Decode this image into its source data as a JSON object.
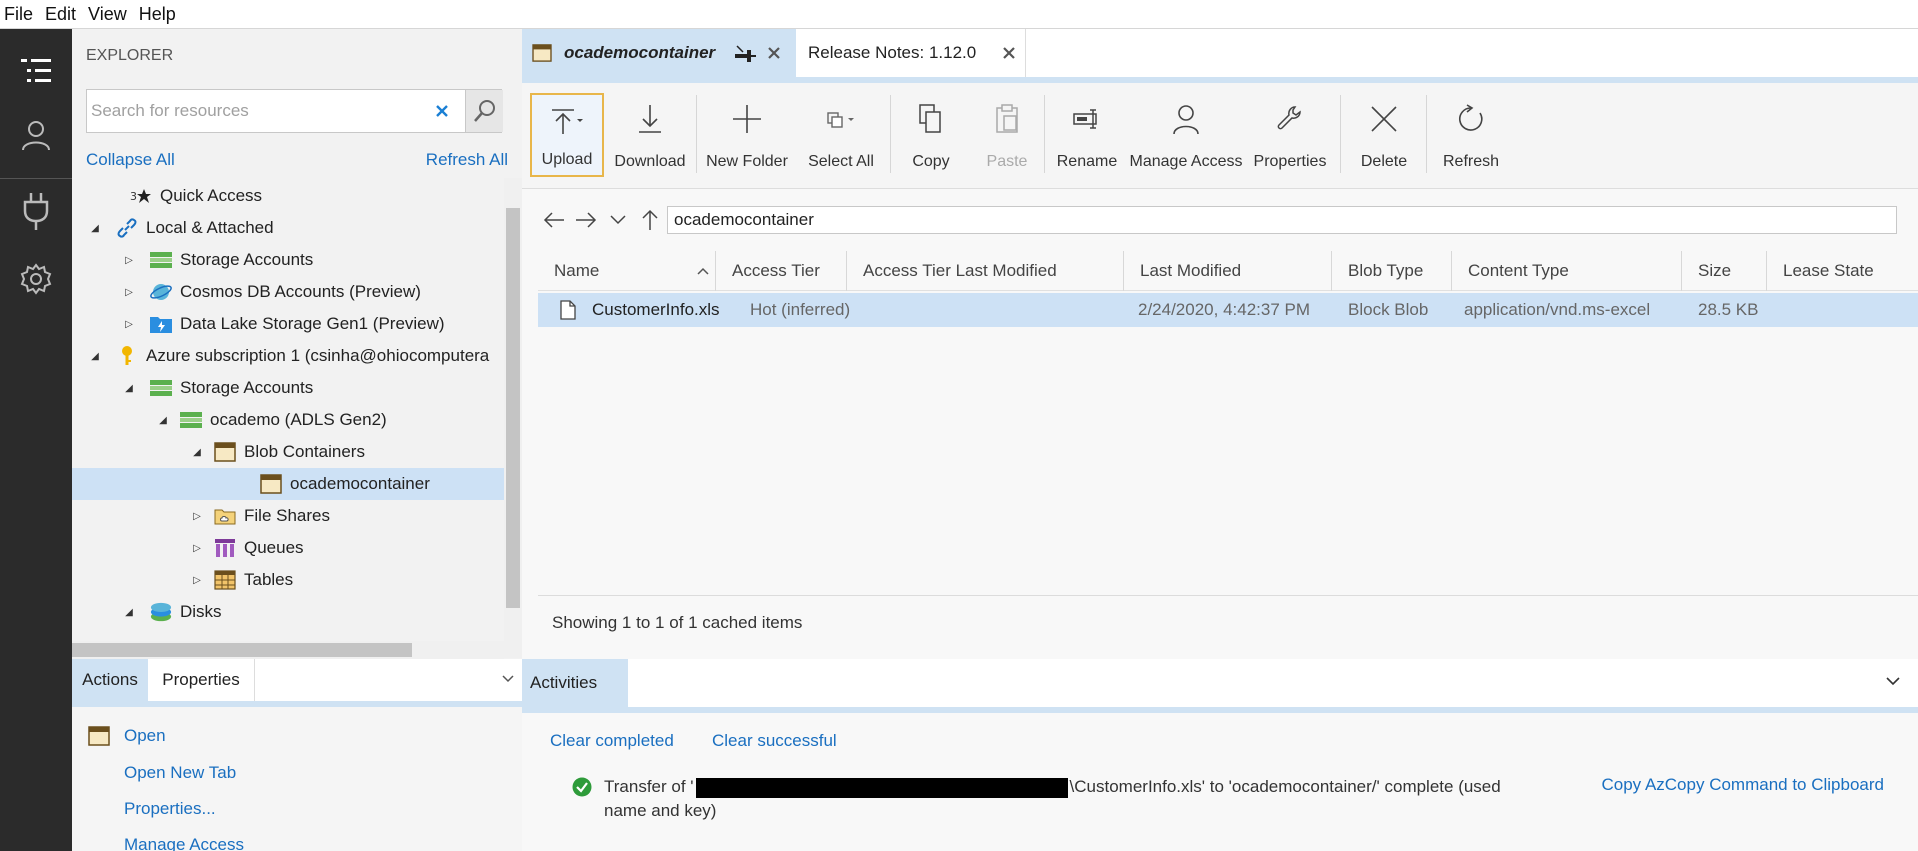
{
  "menu": [
    "File",
    "Edit",
    "View",
    "Help"
  ],
  "explorer": {
    "title": "EXPLORER",
    "search_placeholder": "Search for resources",
    "collapse_all": "Collapse All",
    "refresh_all": "Refresh All",
    "tree": [
      {
        "label": "Quick Access",
        "icon": "quick-access-icon",
        "indent": 0,
        "caret": "none"
      },
      {
        "label": "Local & Attached",
        "icon": "link-icon",
        "indent": 0,
        "caret": "expanded"
      },
      {
        "label": "Storage Accounts",
        "icon": "storage-accounts-icon",
        "indent": 1,
        "caret": "collapsed"
      },
      {
        "label": "Cosmos DB Accounts (Preview)",
        "icon": "cosmos-db-icon",
        "indent": 1,
        "caret": "collapsed"
      },
      {
        "label": "Data Lake Storage Gen1 (Preview)",
        "icon": "data-lake-icon",
        "indent": 1,
        "caret": "collapsed"
      },
      {
        "label": "Azure subscription 1 (csinha@ohiocomputera",
        "icon": "key-icon",
        "indent": 0,
        "caret": "expanded"
      },
      {
        "label": "Storage Accounts",
        "icon": "storage-accounts-icon",
        "indent": 1,
        "caret": "expanded"
      },
      {
        "label": "ocademo (ADLS Gen2)",
        "icon": "storage-account-icon",
        "indent": 2,
        "caret": "expanded"
      },
      {
        "label": "Blob Containers",
        "icon": "blob-containers-icon",
        "indent": 3,
        "caret": "expanded"
      },
      {
        "label": "ocademocontainer",
        "icon": "blob-container-icon",
        "indent": 4,
        "caret": "none",
        "selected": true
      },
      {
        "label": "File Shares",
        "icon": "file-shares-icon",
        "indent": 3,
        "caret": "collapsed"
      },
      {
        "label": "Queues",
        "icon": "queues-icon",
        "indent": 3,
        "caret": "collapsed"
      },
      {
        "label": "Tables",
        "icon": "tables-icon",
        "indent": 3,
        "caret": "collapsed"
      },
      {
        "label": "Disks",
        "icon": "disks-icon",
        "indent": 1,
        "caret": "expanded"
      }
    ]
  },
  "actions_panel": {
    "tabs": [
      "Actions",
      "Properties"
    ],
    "items": [
      "Open",
      "Open New Tab",
      "Properties...",
      "Manage Access"
    ]
  },
  "tabs": [
    {
      "label": "ocademocontainer",
      "active": true
    },
    {
      "label": "Release Notes: 1.12.0",
      "active": false
    }
  ],
  "toolbar": {
    "upload": "Upload",
    "download": "Download",
    "new_folder": "New Folder",
    "select_all": "Select All",
    "copy": "Copy",
    "paste": "Paste",
    "rename": "Rename",
    "manage_access": "Manage Access",
    "properties": "Properties",
    "delete": "Delete",
    "refresh": "Refresh"
  },
  "path": "ocademocontainer",
  "grid": {
    "columns": [
      "Name",
      "Access Tier",
      "Access Tier Last Modified",
      "Last Modified",
      "Blob Type",
      "Content Type",
      "Size",
      "Lease State"
    ],
    "rows": [
      {
        "name": "CustomerInfo.xls",
        "access_tier": "Hot (inferred)",
        "access_tier_last_modified": "",
        "last_modified": "2/24/2020, 4:42:37 PM",
        "blob_type": "Block Blob",
        "content_type": "application/vnd.ms-excel",
        "size": "28.5 KB",
        "lease_state": ""
      }
    ]
  },
  "status": "Showing 1 to 1 of 1 cached items",
  "activities": {
    "tab": "Activities",
    "clear_completed": "Clear completed",
    "clear_successful": "Clear successful",
    "message_prefix": "Transfer of '",
    "message_suffix": "\\CustomerInfo.xls' to 'ocademocontainer/' complete (used name and key)",
    "copy_azcopy": "Copy AzCopy Command to Clipboard"
  },
  "colors": {
    "accent": "#1a6fc0",
    "selection": "#cde1f5",
    "activity_bar": "#2b2b2b",
    "success": "#2e9b3a"
  }
}
